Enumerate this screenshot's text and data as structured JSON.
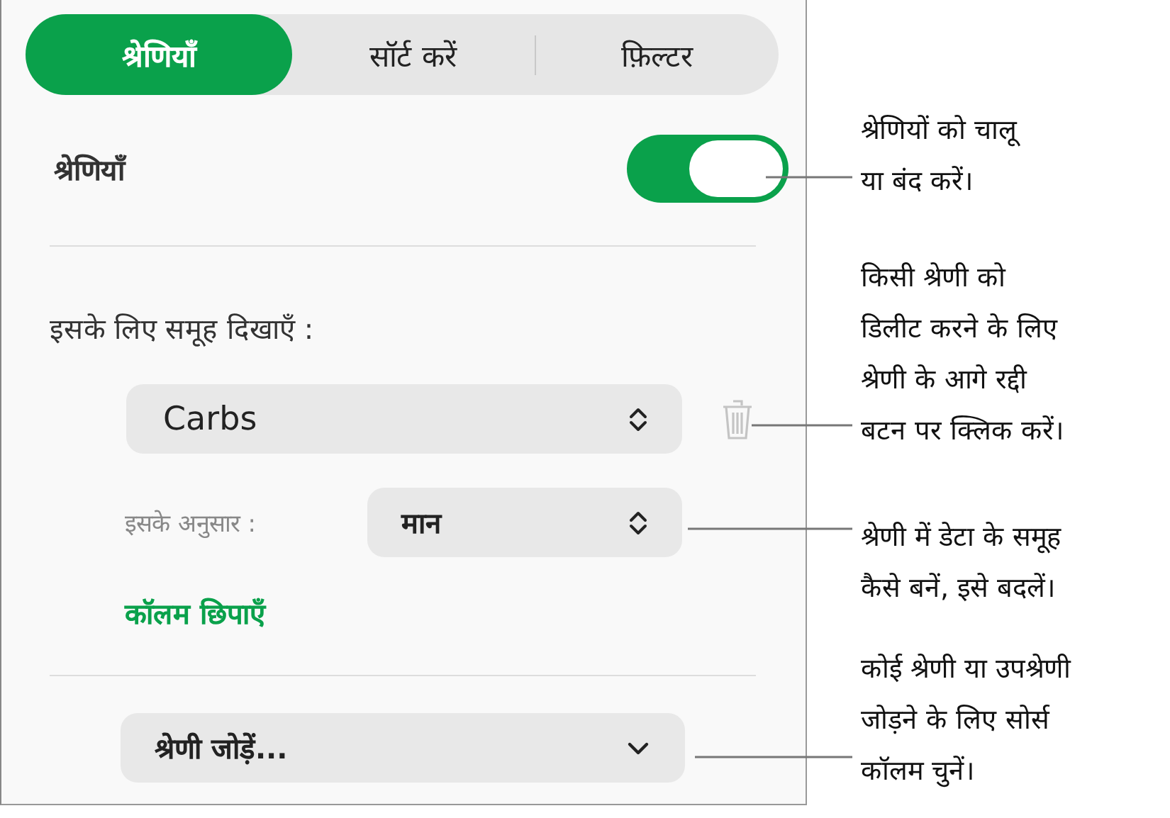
{
  "tabs": [
    {
      "label": "श्रेणियाँ",
      "selected": true
    },
    {
      "label": "सॉर्ट करें",
      "selected": false
    },
    {
      "label": "फ़िल्टर",
      "selected": false
    }
  ],
  "categories_toggle": {
    "label": "श्रेणियाँ",
    "on": true
  },
  "group_by_label": "इसके लिए समूह दिखाएँ :",
  "group_popup": {
    "value": "Carbs"
  },
  "sort_by": {
    "label": "इसके अनुसार :",
    "value": "मान"
  },
  "hide_columns_link": "कॉलम छिपाएँ",
  "add_category": {
    "value": "श्रेणी जोड़ें..."
  },
  "callouts": [
    {
      "text": "श्रेणियों को चालू\nया बंद करें।"
    },
    {
      "text": "किसी श्रेणी को\nडिलीट करने के लिए\nश्रेणी के आगे रद्दी\nबटन पर क्लिक करें।"
    },
    {
      "text": "श्रेणी में डेटा के समूह\nकैसे बनें, इसे बदलें।"
    },
    {
      "text": "कोई श्रेणी या उपश्रेणी\nजोड़ने के लिए सोर्स\nकॉलम चुनें।"
    }
  ]
}
